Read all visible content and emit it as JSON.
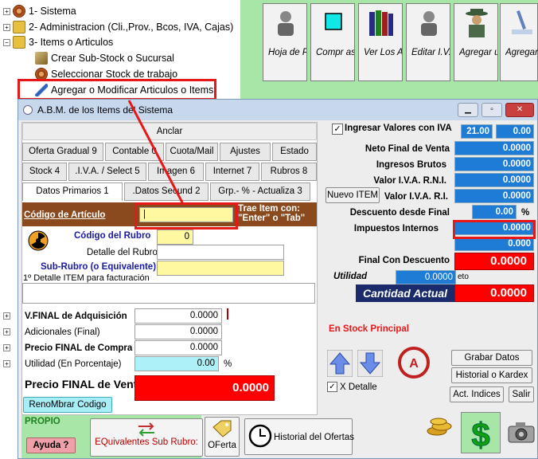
{
  "tree": {
    "items": [
      {
        "label": "1- Sistema"
      },
      {
        "label": "2- Administracion (Cli.,Prov., Bcos, IVA, Cajas)"
      },
      {
        "label": "3- Items o Articulos"
      },
      {
        "label": "Crear Sub-Stock o Sucursal"
      },
      {
        "label": "Seleccionar Stock de trabajo"
      },
      {
        "label": "Agregar o Modificar Articulos o Items"
      }
    ]
  },
  "toolbar": {
    "buttons": [
      {
        "label": "Hoja de Pre Balanc",
        "icon": "person-icon"
      },
      {
        "label": "Compr as o Gastos",
        "icon": "cyan-square-icon"
      },
      {
        "label": "Ver Los Articulo s por",
        "icon": "books-icon"
      },
      {
        "label": "Editar I.V.A. Compr",
        "icon": "person-icon"
      },
      {
        "label": "Agregar un Asiento",
        "icon": "detective-icon"
      },
      {
        "label": "Agregar o Modific",
        "icon": "pen-icon"
      }
    ]
  },
  "window": {
    "title": "A.B.M. de los Items del Sistema",
    "minimize": "▁",
    "restore": "▫",
    "close": "✕"
  },
  "left": {
    "anclar": "Anclar",
    "tabs_row1": [
      "Oferta Gradual 9",
      "Contable 0",
      "Cuota/Mail",
      "Ajustes",
      "Estado"
    ],
    "tabs_row2": [
      "Stock 4",
      ".I.V.A. / Select 5",
      "Imagen 6",
      "Internet 7",
      "Rubros 8"
    ],
    "tabs_row3": [
      "Datos Primarios 1",
      ".Datos Secund 2",
      "Grp.- % - Actualiza 3"
    ],
    "codigo_label": "Código de Artículo",
    "codigo_value": "|",
    "trae_item": "Trae Item con: \"Enter\" o \"Tab\"",
    "codigo_rubro_label": "Código del Rubro",
    "codigo_rubro_value": "0",
    "detalle_rubro_label": "Detalle del Rubro",
    "subrubro_label": "Sub-Rubro (o Equivalente)",
    "detalle_item_label": "1º Detalle ITEM para facturación",
    "vfinal_label": "V.FINAL de Adquisición",
    "vfinal_value": "0.0000",
    "adicionales_label": "Adicionales (Final)",
    "adicionales_value": "0.0000",
    "precio_compra_label": "Precio FINAL de Compra",
    "precio_compra_value": "0.0000",
    "utilidad_label": "Utilidad (En Porcentaje)",
    "utilidad_value": "0.00",
    "pct": "%",
    "precio_venta_label": "Precio FINAL de  Venta",
    "precio_venta_value": "0.0000",
    "renombrar": "RenoMbrar Codigo",
    "propio": "PROPIO",
    "ayuda": "Ayuda ?",
    "equivalentes": "EQuivalentes Sub Rubro:",
    "oferta": "OFerta",
    "historial_ofertas": "Historial del Ofertas"
  },
  "right": {
    "ingresar_iva": "Ingresar Valores con IVA",
    "iva_rate": "21.00",
    "iva_value": "0.00",
    "neto_label": "Neto Final de Venta",
    "neto_value": "0.0000",
    "ingresos_label": "Ingresos Brutos",
    "ingresos_value": "0.0000",
    "iva_rni_label": "Valor I.V.A. R.N.I.",
    "iva_rni_value": "0.0000",
    "nuevo_item": "Nuevo ITEM",
    "iva_ri_label": "Valor I.V.A. R.I.",
    "iva_ri_value": "0.0000",
    "descuento_label": "Descuento desde Final",
    "descuento_value": "0.00",
    "descuento_pct": "%",
    "impuestos_label": "Impuestos Internos",
    "impuestos_value": "0.0000",
    "blank_value": "0.000",
    "final_desc_label": "Final Con Descuento",
    "final_desc_value": "0.0000",
    "utilidad_label": "Utilidad",
    "utilidad_value": "0.0000",
    "neto_suffix": "eto",
    "cantidad_label": "Cantidad Actual",
    "cantidad_value": "0.0000",
    "en_stock": "En Stock Principal",
    "grabar": "Grabar Datos",
    "historial_kardex": "Historial o Kardex",
    "x_detalle": "X Detalle",
    "act_indices": "Act. Indices",
    "salir": "Salir"
  }
}
